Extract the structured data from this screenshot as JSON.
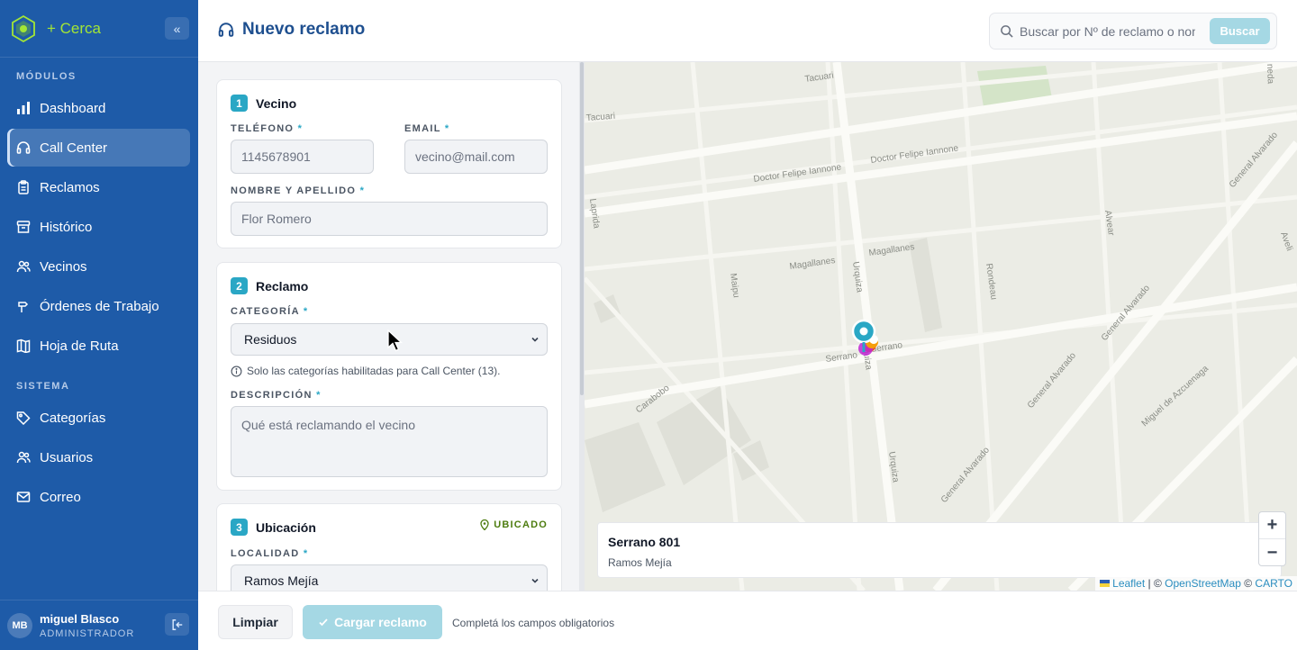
{
  "brand": {
    "name": "+ Cerca"
  },
  "sidebar": {
    "section_modules": "MÓDULOS",
    "section_system": "SISTEMA",
    "items": [
      {
        "label": "Dashboard",
        "icon": "bar-chart-icon"
      },
      {
        "label": "Call Center",
        "icon": "headset-icon",
        "active": true
      },
      {
        "label": "Reclamos",
        "icon": "clipboard-icon"
      },
      {
        "label": "Histórico",
        "icon": "archive-icon"
      },
      {
        "label": "Vecinos",
        "icon": "users-icon"
      },
      {
        "label": "Órdenes de Trabajo",
        "icon": "hammer-icon"
      },
      {
        "label": "Hoja de Ruta",
        "icon": "map-icon"
      },
      {
        "label": "Categorías",
        "icon": "tag-icon"
      },
      {
        "label": "Usuarios",
        "icon": "users-icon"
      },
      {
        "label": "Correo",
        "icon": "mail-icon"
      }
    ],
    "user": {
      "initials": "MB",
      "name": "miguel Blasco",
      "role": "ADMINISTRADOR"
    }
  },
  "header": {
    "title": "Nuevo reclamo",
    "search_placeholder": "Buscar por Nº de reclamo o nombre",
    "search_button": "Buscar"
  },
  "form": {
    "vecino": {
      "step": "1",
      "title": "Vecino",
      "phone_label": "TELÉFONO",
      "phone_placeholder": "1145678901",
      "email_label": "EMAIL",
      "email_placeholder": "vecino@mail.com",
      "name_label": "NOMBRE Y APELLIDO",
      "name_placeholder": "Flor Romero"
    },
    "reclamo": {
      "step": "2",
      "title": "Reclamo",
      "category_label": "CATEGORÍA",
      "category_value": "Residuos",
      "category_hint": "Solo las categorías habilitadas para Call Center (13).",
      "description_label": "DESCRIPCIÓN",
      "description_placeholder": "Qué está reclamando el vecino"
    },
    "ubicacion": {
      "step": "3",
      "title": "Ubicación",
      "status": "UBICADO",
      "locality_label": "LOCALIDAD",
      "locality_value": "Ramos Mejía"
    },
    "required_mark": "*"
  },
  "footer": {
    "clear_button": "Limpiar",
    "submit_button": "Cargar reclamo",
    "message": "Completá los campos obligatorios"
  },
  "map": {
    "streets": [
      "Tacuari",
      "Tacuari",
      "Doctor Felipe Iannone",
      "Doctor Felipe Iannone",
      "Magallanes",
      "Magallanes",
      "Laprida",
      "Maipu",
      "Urquiza",
      "Urquiza",
      "Urquiza",
      "Rondeau",
      "Alvear",
      "General Alvarado",
      "General Alvarado",
      "General Alvarado",
      "General Alvarado",
      "General Alvarado",
      "Serrano",
      "Serrano",
      "Carabobo",
      "Miguel de Azcuenaga",
      "Aveli",
      "neda"
    ],
    "address_title": "Serrano 801",
    "address_locality": "Ramos Mejía",
    "zoom_in": "+",
    "zoom_out": "−",
    "attribution": {
      "leaflet": "Leaflet",
      "sep1": "| ©",
      "osm": "OpenStreetMap",
      "sep2": "©",
      "carto": "CARTO"
    }
  }
}
